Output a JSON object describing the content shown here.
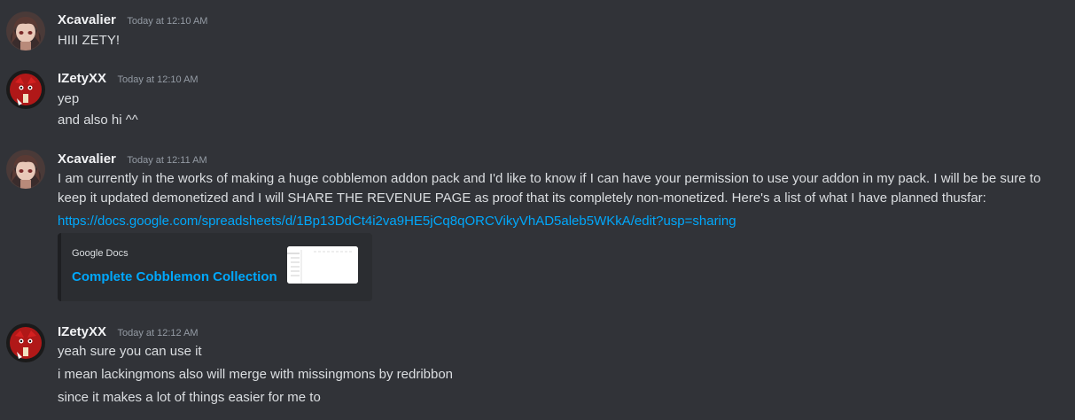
{
  "messages": [
    {
      "username": "Xcavalier",
      "timestamp": "Today at 12:10 AM",
      "lines": [
        "HIII ZETY!"
      ]
    },
    {
      "username": "IZetyXX",
      "timestamp": "Today at 12:10 AM",
      "lines": [
        "yep",
        "and also hi ^^"
      ]
    },
    {
      "username": "Xcavalier",
      "timestamp": "Today at 12:11 AM",
      "text": "I am currently in the works of making a huge cobblemon addon pack and I'd like to know if I can have your permission to use your addon in my pack. I will be be sure to keep it updated demonetized and I will SHARE THE REVENUE PAGE as proof that its completely non-monetized. Here's a list of what I have planned thusfar:",
      "link": "https://docs.google.com/spreadsheets/d/1Bp13DdCt4i2va9HE5jCq8qORCVikyVhAD5aleb5WKkA/edit?usp=sharing",
      "embed": {
        "provider": "Google Docs",
        "title": "Complete Cobblemon Collection"
      }
    },
    {
      "username": "IZetyXX",
      "timestamp": "Today at 12:12 AM",
      "lines": [
        "yeah sure you can use it",
        "i mean lackingmons also will merge with missingmons by redribbon",
        "since it makes a lot of things easier for me to"
      ]
    }
  ],
  "colors": {
    "background": "#313338",
    "username": "#f2f3f5",
    "text": "#dbdee1",
    "timestamp": "#949ba4",
    "link": "#00a8fc",
    "embed_bg": "#2b2d31"
  },
  "icons": {
    "avatar_xcavalier": "anime-character-avatar",
    "avatar_izetyxx": "red-creature-avatar",
    "embed_thumbnail": "spreadsheet-thumbnail"
  }
}
